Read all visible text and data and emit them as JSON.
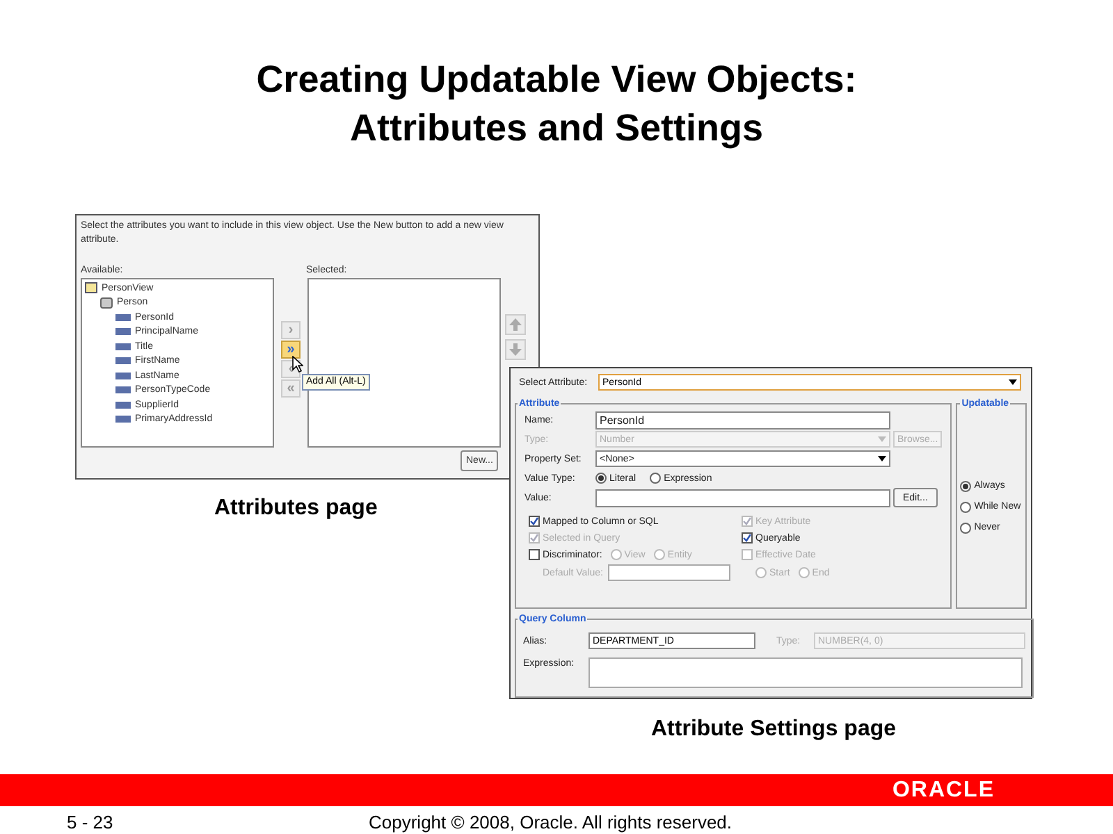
{
  "slide": {
    "title_lines": [
      "Creating Updatable View Objects:",
      "Attributes and Settings"
    ]
  },
  "attributes_page": {
    "instructions": "Select the attributes you want to include in this view object.  Use the New button to add a new view attribute.",
    "available_label": "Available:",
    "selected_label": "Selected:",
    "tree": [
      {
        "label": "PersonView",
        "kind": "view",
        "children": [
          {
            "label": "Person",
            "kind": "entity",
            "children": [
              {
                "label": "PersonId",
                "kind": "attribute"
              },
              {
                "label": "PrincipalName",
                "kind": "attribute"
              },
              {
                "label": "Title",
                "kind": "attribute"
              },
              {
                "label": "FirstName",
                "kind": "attribute"
              },
              {
                "label": "LastName",
                "kind": "attribute"
              },
              {
                "label": "PersonTypeCode",
                "kind": "attribute"
              },
              {
                "label": "SupplierId",
                "kind": "attribute"
              },
              {
                "label": "PrimaryAddressId",
                "kind": "attribute"
              }
            ]
          }
        ]
      }
    ],
    "shuttle_buttons": [
      {
        "glyph": "›",
        "highlighted": false
      },
      {
        "glyph": "»",
        "highlighted": true
      },
      {
        "glyph": "‹",
        "highlighted": false
      },
      {
        "glyph": "«",
        "highlighted": false
      }
    ],
    "tooltip": "Add All (Alt-L)",
    "new_button": "New...",
    "caption": "Attributes page"
  },
  "settings_page": {
    "select_attribute": {
      "label": "Select Attribute:",
      "value": "PersonId"
    },
    "attribute_group": {
      "title": "Attribute",
      "name": {
        "label": "Name:",
        "value": "PersonId"
      },
      "type": {
        "label": "Type:",
        "value": "Number",
        "disabled": true
      },
      "browse_button": {
        "label": "Browse...",
        "disabled": true
      },
      "property_set": {
        "label": "Property Set:",
        "value": "<None>"
      },
      "value_type": {
        "label": "Value Type:",
        "options": [
          {
            "label": "Literal",
            "selected": true
          },
          {
            "label": "Expression",
            "selected": false
          }
        ]
      },
      "value": {
        "label": "Value:"
      },
      "edit_button": "Edit...",
      "checkboxes": [
        {
          "label": "Mapped to Column or SQL",
          "checked": true,
          "disabled": false
        },
        {
          "label": "Key Attribute",
          "checked": true,
          "disabled": true
        },
        {
          "label": "Selected in Query",
          "checked": true,
          "disabled": true
        },
        {
          "label": "Queryable",
          "checked": true,
          "disabled": false
        },
        {
          "label": "Discriminator:",
          "checked": false,
          "disabled": false
        },
        {
          "label": "Effective Date",
          "checked": false,
          "disabled": true
        }
      ],
      "discriminator_options": [
        {
          "label": "View",
          "selected": false,
          "disabled": true
        },
        {
          "label": "Entity",
          "selected": false,
          "disabled": true
        }
      ],
      "effective_date_options": [
        {
          "label": "Start",
          "selected": false,
          "disabled": true
        },
        {
          "label": "End",
          "selected": false,
          "disabled": true
        }
      ],
      "default_value": {
        "label": "Default Value:",
        "disabled": true
      }
    },
    "updatable_group": {
      "title": "Updatable",
      "options": [
        {
          "label": "Always",
          "selected": true
        },
        {
          "label": "While New",
          "selected": false
        },
        {
          "label": "Never",
          "selected": false
        }
      ]
    },
    "query_column_group": {
      "title": "Query Column",
      "alias": {
        "label": "Alias:",
        "value": "DEPARTMENT_ID"
      },
      "type": {
        "label": "Type:",
        "value": "NUMBER(4, 0)",
        "disabled": true
      },
      "expression": {
        "label": "Expression:"
      }
    },
    "caption": "Attribute Settings page"
  },
  "footer": {
    "page": "5 - 23",
    "copyright": "Copyright © 2008, Oracle. All rights reserved.",
    "logo": "ORACLE"
  }
}
